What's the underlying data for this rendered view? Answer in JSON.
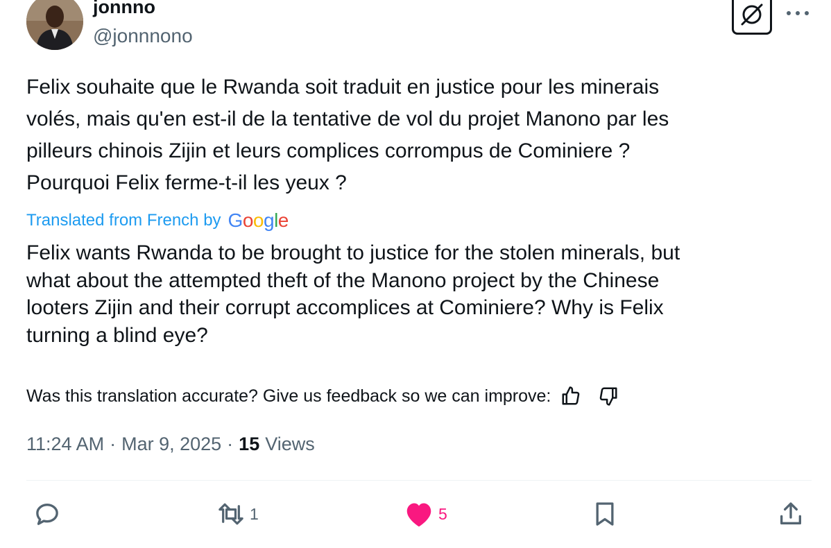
{
  "author": {
    "display_name": "jonnno",
    "handle": "@jonnnono",
    "avatar_icon": "profile-photo"
  },
  "header_actions": {
    "grok_icon": "grok-icon",
    "more_icon": "more-horizontal-icon"
  },
  "tweet": {
    "text": "Felix souhaite que le Rwanda soit traduit en justice pour les minerais\nvolés, mais qu'en est-il de la tentative de vol du projet Manono par les\npilleurs chinois Zijin et leurs complices corrompus de Cominiere ?\nPourquoi Felix ferme-t-il les yeux ?",
    "translated_label": "Translated from French by",
    "translated_provider": "Google",
    "translation": "Felix wants Rwanda to be brought to justice for the stolen minerals, but\nwhat about the attempted theft of the Manono project by the Chinese\nlooters Zijin and their corrupt accomplices at Cominiere? Why is Felix\nturning a blind eye?",
    "feedback_prompt": "Was this translation accurate? Give us feedback so we can improve:"
  },
  "meta": {
    "time": "11:24 AM",
    "separator": "·",
    "date": "Mar 9, 2025",
    "views_count": "15",
    "views_label": "Views"
  },
  "actions": {
    "reply": {
      "icon": "reply-icon",
      "count": ""
    },
    "repost": {
      "icon": "repost-icon",
      "count": "1"
    },
    "like": {
      "icon": "heart-filled-icon",
      "count": "5",
      "liked": true
    },
    "bookmark": {
      "icon": "bookmark-icon"
    },
    "share": {
      "icon": "share-icon"
    }
  },
  "colors": {
    "text": "#0f1419",
    "secondary": "#536471",
    "link": "#1d9bf0",
    "like": "#f91880",
    "divider": "#eff3f4"
  }
}
